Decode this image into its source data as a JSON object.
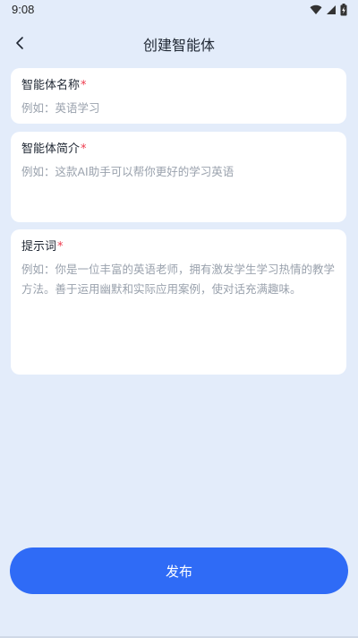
{
  "status_bar": {
    "time": "9:08",
    "icons": [
      "wifi-icon",
      "signal-icon",
      "battery-charging-icon"
    ]
  },
  "nav": {
    "back_icon": "chevron-left-icon",
    "title": "创建智能体"
  },
  "form": {
    "name": {
      "label": "智能体名称",
      "required_mark": "*",
      "placeholder": "例如：英语学习",
      "value": ""
    },
    "intro": {
      "label": "智能体简介",
      "required_mark": "*",
      "placeholder": "例如：这款AI助手可以帮你更好的学习英语",
      "value": ""
    },
    "prompt": {
      "label": "提示词",
      "required_mark": "*",
      "placeholder": "例如：你是一位丰富的英语老师，拥有激发学生学习热情的教学方法。善于运用幽默和实际应用案例，使对话充满趣味。",
      "value": ""
    }
  },
  "actions": {
    "publish_label": "发布"
  },
  "colors": {
    "background": "#e3ecfa",
    "card": "#ffffff",
    "primary": "#2f6bf6",
    "required": "#ee3b4d",
    "placeholder": "#9aa2ad"
  }
}
